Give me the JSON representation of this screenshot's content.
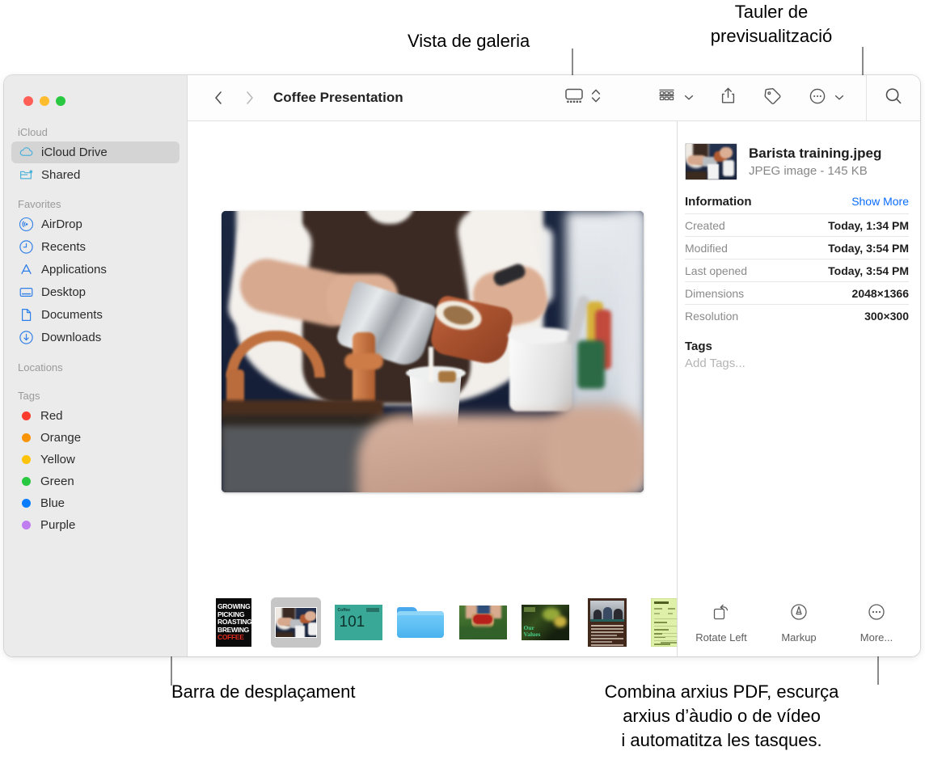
{
  "annotations": {
    "gallery_view": "Vista de galeria",
    "preview_panel": "Tauler de\nprevisualització",
    "scroll_bar": "Barra de desplaçament",
    "more_actions": "Combina arxius PDF, escurça\narxius d’àudio o de vídeo\ni automatitza les tasques."
  },
  "window": {
    "title": "Coffee Presentation",
    "traffic_lights": [
      "close",
      "minimize",
      "zoom"
    ]
  },
  "toolbar": {
    "back_icon": "chevron-left-icon",
    "forward_icon": "chevron-right-icon",
    "view_gallery_icon": "gallery-view-icon",
    "view_stepper_icon": "chevron-up-down-icon",
    "group_icon": "group-items-icon",
    "group_chevron_icon": "chevron-down-icon",
    "share_icon": "share-icon",
    "tag_icon": "tag-icon",
    "more_icon": "ellipsis-circle-icon",
    "more_chevron_icon": "chevron-down-icon",
    "search_icon": "search-icon"
  },
  "sidebar": {
    "sections": [
      {
        "header": "iCloud",
        "items": [
          {
            "label": "iCloud Drive",
            "icon": "icloud-icon",
            "selected": true
          },
          {
            "label": "Shared",
            "icon": "shared-folder-icon",
            "selected": false
          }
        ]
      },
      {
        "header": "Favorites",
        "items": [
          {
            "label": "AirDrop",
            "icon": "airdrop-icon",
            "selected": false
          },
          {
            "label": "Recents",
            "icon": "clock-icon",
            "selected": false
          },
          {
            "label": "Applications",
            "icon": "applications-icon",
            "selected": false
          },
          {
            "label": "Desktop",
            "icon": "desktop-icon",
            "selected": false
          },
          {
            "label": "Documents",
            "icon": "document-icon",
            "selected": false
          },
          {
            "label": "Downloads",
            "icon": "downloads-icon",
            "selected": false
          }
        ]
      },
      {
        "header": "Locations",
        "items": []
      },
      {
        "header": "Tags",
        "items": [
          {
            "label": "Red",
            "icon": "tag-dot-icon",
            "color": "#fc3b2f"
          },
          {
            "label": "Orange",
            "icon": "tag-dot-icon",
            "color": "#f89406"
          },
          {
            "label": "Yellow",
            "icon": "tag-dot-icon",
            "color": "#fdc309"
          },
          {
            "label": "Green",
            "icon": "tag-dot-icon",
            "color": "#28c840"
          },
          {
            "label": "Blue",
            "icon": "tag-dot-icon",
            "color": "#0a7cff"
          },
          {
            "label": "Purple",
            "icon": "tag-dot-icon",
            "color": "#c07df0"
          }
        ]
      }
    ]
  },
  "gallery": {
    "hero_alt": "Barista pouring milk from a copper pitcher into a white cup",
    "thumbnails": [
      {
        "name": "growing-picking-roasting-brewing-coffee-slide",
        "lines": [
          "GROWING",
          "PICKING",
          "ROASTING",
          "BREWING"
        ],
        "accent_line": "COFFEE",
        "selected": false
      },
      {
        "name": "barista-training-photo",
        "selected": true
      },
      {
        "name": "coffee-101-slide",
        "title": "Coffee",
        "number": "101",
        "selected": false
      },
      {
        "name": "folder",
        "selected": false
      },
      {
        "name": "coffee-cherries-photo",
        "selected": false
      },
      {
        "name": "our-values-slide",
        "line1": "Our",
        "line2": "Values",
        "selected": false
      },
      {
        "name": "meeting-document",
        "selected": false
      },
      {
        "name": "price-list-spreadsheet",
        "selected": false
      }
    ]
  },
  "preview": {
    "file_name": "Barista training.jpeg",
    "file_kind": "JPEG image - 145 KB",
    "information_title": "Information",
    "show_more": "Show More",
    "rows": [
      {
        "key": "Created",
        "value": "Today, 1:34 PM"
      },
      {
        "key": "Modified",
        "value": "Today, 3:54 PM"
      },
      {
        "key": "Last opened",
        "value": "Today, 3:54 PM"
      },
      {
        "key": "Dimensions",
        "value": "2048×1366"
      },
      {
        "key": "Resolution",
        "value": "300×300"
      }
    ],
    "tags_title": "Tags",
    "add_tags_placeholder": "Add Tags...",
    "actions": [
      {
        "label": "Rotate Left",
        "icon": "rotate-left-icon"
      },
      {
        "label": "Markup",
        "icon": "markup-icon"
      },
      {
        "label": "More...",
        "icon": "ellipsis-circle-icon"
      }
    ]
  },
  "colors": {
    "accent_blue": "#0a6cff",
    "sidebar_bg": "#ebebeb",
    "selected_row": "#d4d4d4",
    "leader_line": "#8a8a8a"
  }
}
